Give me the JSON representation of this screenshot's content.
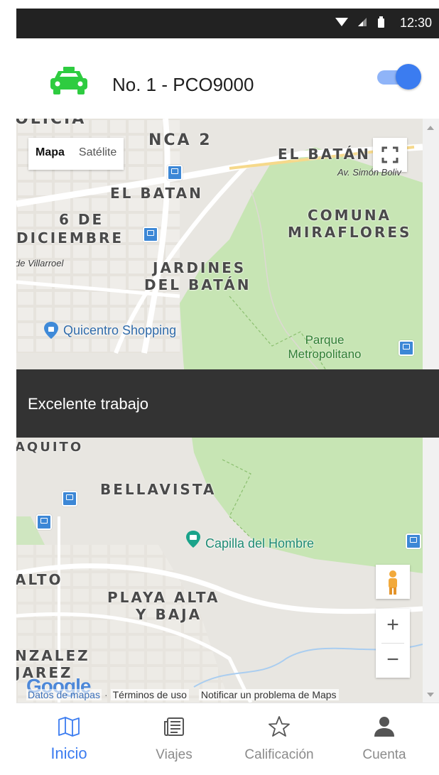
{
  "status_bar": {
    "time": "12:30"
  },
  "header": {
    "vehicle_label": "No. 1 - PCO9000",
    "online_toggle": true,
    "accent_color": "#3b7cf0",
    "taxi_icon_color": "#2ecc40"
  },
  "map": {
    "map_type_options": [
      "Mapa",
      "Satélite"
    ],
    "map_type_selected": "Mapa",
    "area_labels": [
      "OLICIA",
      "NCA 2",
      "EL BATÁN",
      "EL BATAN",
      "6 DE",
      "DICIEMBRE",
      "COMUNA",
      "MIRAFLORES",
      "JARDINES",
      "DEL BATÁN",
      "BELLAVISTA",
      "ALTO",
      "PLAYA ALTA",
      "Y BAJA",
      "NZALEZ",
      "JAREZ",
      "AQUITO"
    ],
    "street_labels": [
      "Av. Simón Boliv",
      "de Villarroel"
    ],
    "poi_labels": [
      "Quicentro Shopping",
      "Parque",
      "Metropolitano",
      "Capilla del Hombre"
    ],
    "zoom_in_label": "+",
    "zoom_out_label": "−",
    "logo": "Google",
    "attribution": {
      "map_data": "Datos de mapas",
      "separator": "·",
      "terms": "Términos de uso",
      "report": "Notificar un problema de Maps"
    }
  },
  "snackbar": {
    "message": "Excelente trabajo"
  },
  "bottom_nav": [
    {
      "label": "Inicio",
      "icon": "map-icon",
      "active": true
    },
    {
      "label": "Viajes",
      "icon": "newspaper-icon",
      "active": false
    },
    {
      "label": "Calificación",
      "icon": "star-icon",
      "active": false
    },
    {
      "label": "Cuenta",
      "icon": "person-icon",
      "active": false
    }
  ]
}
